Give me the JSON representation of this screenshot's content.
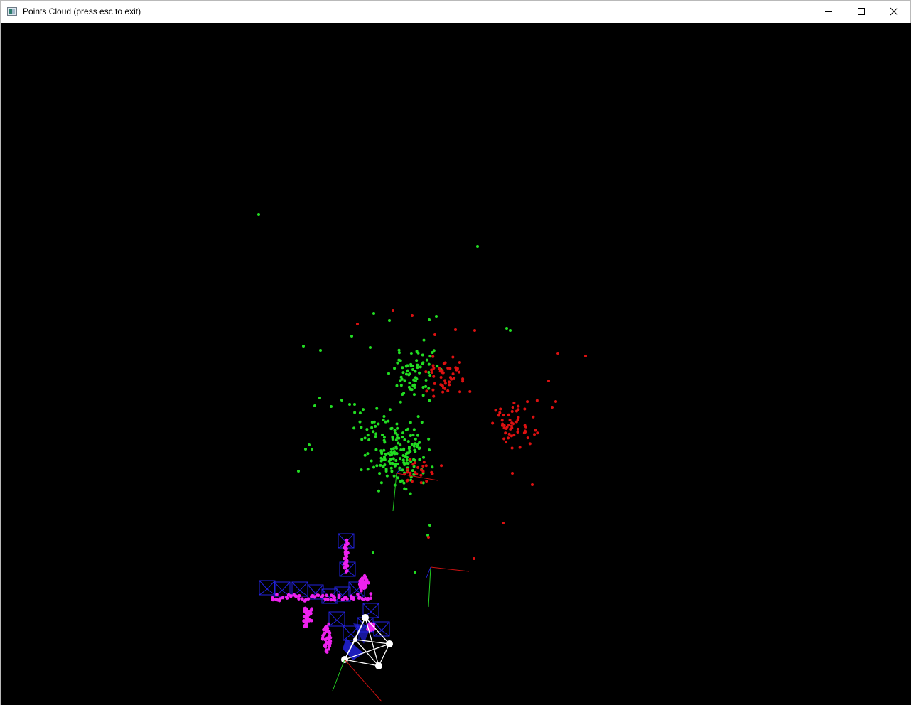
{
  "window": {
    "title": "Points Cloud (press esc to exit)",
    "icons": {
      "app": "window-app-icon",
      "minimize": "minimize-icon",
      "maximize": "maximize-icon",
      "close": "close-icon"
    }
  },
  "scene": {
    "background": "#000000",
    "colors": {
      "points_green": "#22dd22",
      "points_red": "#dd1111",
      "trajectory_points": "#ee22ee",
      "camera_frames": "#2222dd",
      "current_camera": "#ffffff",
      "axis_x": "#cc1111",
      "axis_y": "#22cc22",
      "axis_z": "#2222cc"
    }
  }
}
